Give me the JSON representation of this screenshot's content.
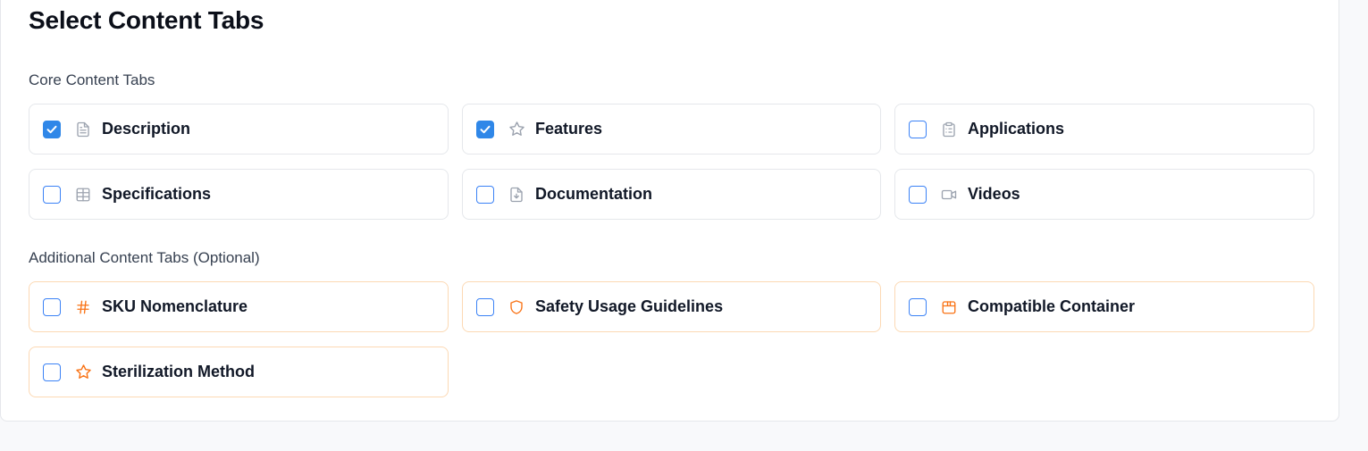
{
  "title": "Select Content Tabs",
  "core": {
    "heading": "Core Content Tabs",
    "items": [
      {
        "label": "Description",
        "icon": "file-text-icon",
        "checked": true
      },
      {
        "label": "Features",
        "icon": "star-icon",
        "checked": true
      },
      {
        "label": "Applications",
        "icon": "clipboard-list-icon",
        "checked": false
      },
      {
        "label": "Specifications",
        "icon": "table-icon",
        "checked": false
      },
      {
        "label": "Documentation",
        "icon": "file-download-icon",
        "checked": false
      },
      {
        "label": "Videos",
        "icon": "video-icon",
        "checked": false
      }
    ]
  },
  "additional": {
    "heading": "Additional Content Tabs (Optional)",
    "items": [
      {
        "label": "SKU Nomenclature",
        "icon": "hash-icon",
        "checked": false
      },
      {
        "label": "Safety Usage Guidelines",
        "icon": "shield-icon",
        "checked": false
      },
      {
        "label": "Compatible Container",
        "icon": "container-icon",
        "checked": false
      },
      {
        "label": "Sterilization Method",
        "icon": "star-icon",
        "checked": false
      }
    ]
  },
  "colors": {
    "checkbox_blue": "#2f87e8",
    "core_icon": "#9ca3af",
    "optional_icon": "#f97316",
    "optional_border": "#fcd9b4"
  }
}
